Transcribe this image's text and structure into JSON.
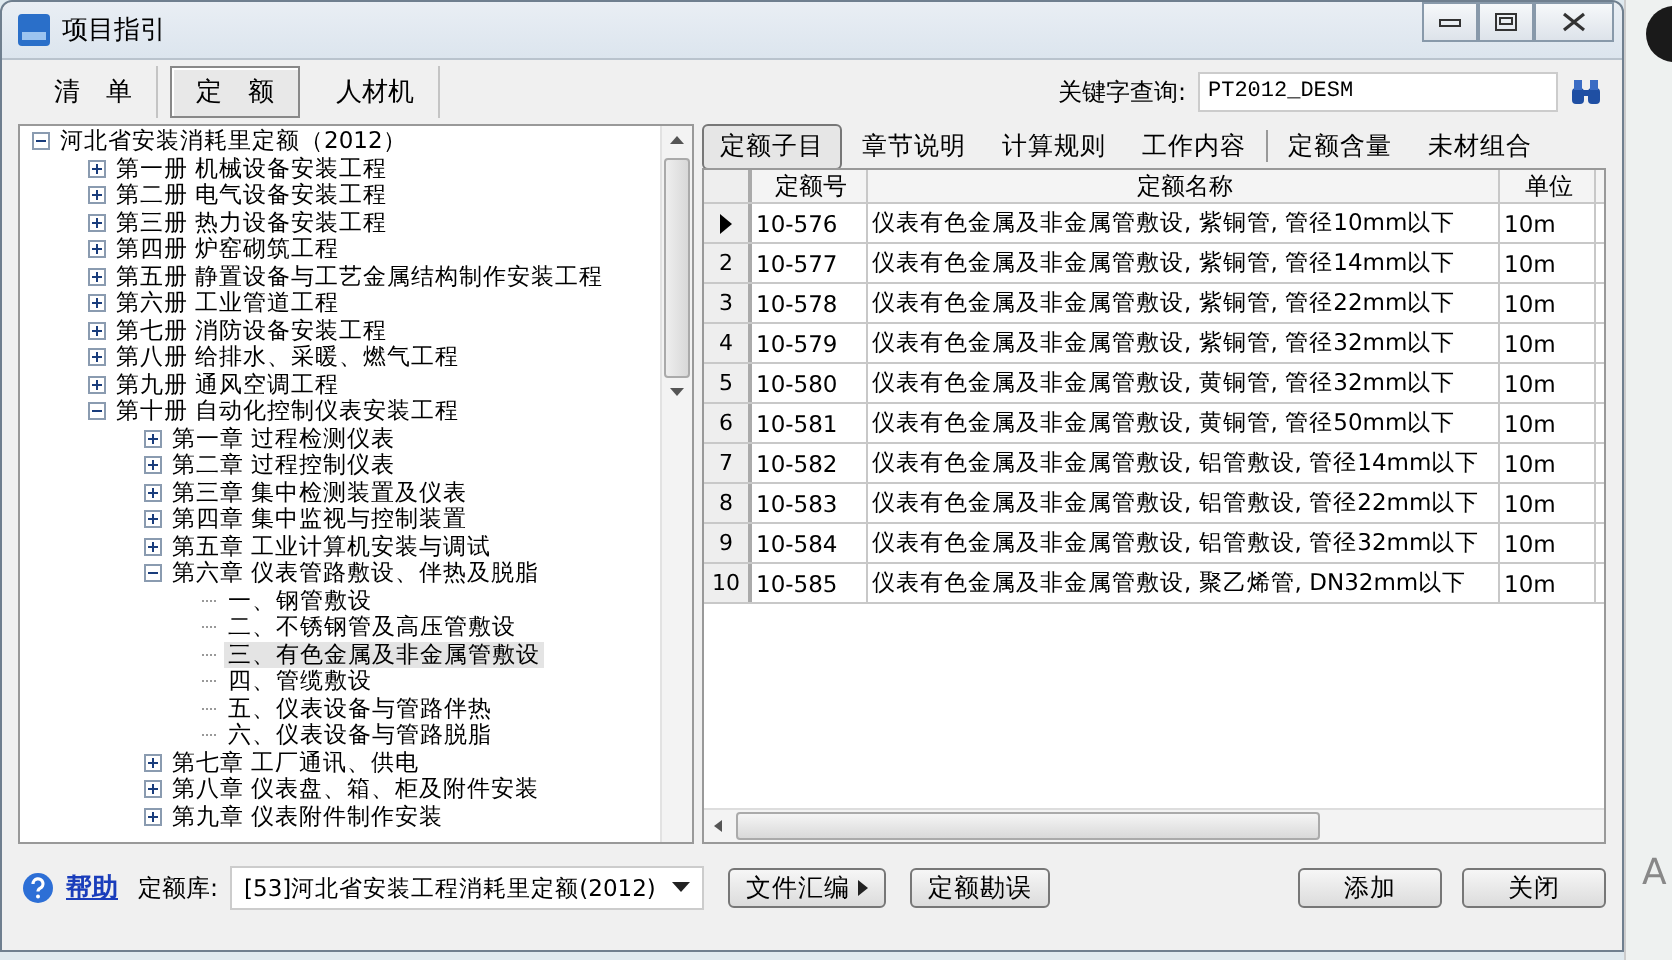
{
  "window": {
    "title": "项目指引"
  },
  "mode_tabs": [
    {
      "label": "清　单",
      "selected": false
    },
    {
      "label": "定　额",
      "selected": true
    },
    {
      "label": "人材机",
      "selected": false
    }
  ],
  "search": {
    "label": "关键字查询:",
    "value": "PT2012_DESM"
  },
  "tree": [
    {
      "label": "河北省安装消耗里定额（2012）",
      "expanded": true,
      "children": [
        {
          "label": "第一册  机械设备安装工程",
          "expanded": false
        },
        {
          "label": "第二册  电气设备安装工程",
          "expanded": false
        },
        {
          "label": "第三册  热力设备安装工程",
          "expanded": false
        },
        {
          "label": "第四册  炉窑砌筑工程",
          "expanded": false
        },
        {
          "label": "第五册  静置设备与工艺金属结构制作安装工程",
          "expanded": false
        },
        {
          "label": "第六册  工业管道工程",
          "expanded": false
        },
        {
          "label": "第七册  消防设备安装工程",
          "expanded": false
        },
        {
          "label": "第八册  给排水、采暖、燃气工程",
          "expanded": false
        },
        {
          "label": "第九册  通风空调工程",
          "expanded": false
        },
        {
          "label": "第十册  自动化控制仪表安装工程",
          "expanded": true,
          "children": [
            {
              "label": "第一章  过程检测仪表",
              "expanded": false
            },
            {
              "label": "第二章  过程控制仪表",
              "expanded": false
            },
            {
              "label": "第三章  集中检测装置及仪表",
              "expanded": false
            },
            {
              "label": "第四章  集中监视与控制装置",
              "expanded": false
            },
            {
              "label": "第五章  工业计算机安装与调试",
              "expanded": false
            },
            {
              "label": "第六章  仪表管路敷设、伴热及脱脂",
              "expanded": true,
              "children": [
                {
                  "label": "一、钢管敷设",
                  "selected": false
                },
                {
                  "label": "二、不锈钢管及高压管敷设",
                  "selected": false
                },
                {
                  "label": "三、有色金属及非金属管敷设",
                  "selected": true
                },
                {
                  "label": "四、管缆敷设",
                  "selected": false
                },
                {
                  "label": "五、仪表设备与管路伴热",
                  "selected": false
                },
                {
                  "label": "六、仪表设备与管路脱脂",
                  "selected": false
                }
              ]
            },
            {
              "label": "第七章  工厂通讯、供电",
              "expanded": false
            },
            {
              "label": "第八章  仪表盘、箱、柜及附件安装",
              "expanded": false
            },
            {
              "label": "第九章  仪表附件制作安装",
              "expanded": false
            }
          ]
        }
      ]
    }
  ],
  "detail_tabs": [
    {
      "label": "定额子目",
      "selected": true
    },
    {
      "label": "章节说明",
      "selected": false
    },
    {
      "label": "计算规则",
      "selected": false
    },
    {
      "label": "工作内容",
      "selected": false
    },
    {
      "label": "定额含量",
      "selected": false
    },
    {
      "label": "未材组合",
      "selected": false
    }
  ],
  "table": {
    "columns": [
      "定额号",
      "定额名称",
      "单位"
    ],
    "rows": [
      {
        "current": true,
        "cells": [
          "10-576",
          "仪表有色金属及非金属管敷设, 紫铜管, 管径10mm以下",
          "10m"
        ]
      },
      {
        "index": "2",
        "current": false,
        "cells": [
          "10-577",
          "仪表有色金属及非金属管敷设, 紫铜管, 管径14mm以下",
          "10m"
        ]
      },
      {
        "index": "3",
        "current": false,
        "cells": [
          "10-578",
          "仪表有色金属及非金属管敷设, 紫铜管, 管径22mm以下",
          "10m"
        ]
      },
      {
        "index": "4",
        "current": false,
        "cells": [
          "10-579",
          "仪表有色金属及非金属管敷设, 紫铜管, 管径32mm以下",
          "10m"
        ]
      },
      {
        "index": "5",
        "current": false,
        "cells": [
          "10-580",
          "仪表有色金属及非金属管敷设, 黄铜管, 管径32mm以下",
          "10m"
        ]
      },
      {
        "index": "6",
        "current": false,
        "cells": [
          "10-581",
          "仪表有色金属及非金属管敷设, 黄铜管, 管径50mm以下",
          "10m"
        ]
      },
      {
        "index": "7",
        "current": false,
        "cells": [
          "10-582",
          "仪表有色金属及非金属管敷设, 铝管敷设, 管径14mm以下",
          "10m"
        ]
      },
      {
        "index": "8",
        "current": false,
        "cells": [
          "10-583",
          "仪表有色金属及非金属管敷设, 铝管敷设, 管径22mm以下",
          "10m"
        ]
      },
      {
        "index": "9",
        "current": false,
        "cells": [
          "10-584",
          "仪表有色金属及非金属管敷设, 铝管敷设, 管径32mm以下",
          "10m"
        ]
      },
      {
        "index": "10",
        "current": false,
        "cells": [
          "10-585",
          "仪表有色金属及非金属管敷设, 聚乙烯管, DN32mm以下",
          "10m"
        ]
      }
    ]
  },
  "footer": {
    "help": "帮助",
    "library_label": "定额库:",
    "library": "[53]河北省安装工程消耗里定额(2012)",
    "buttons": [
      {
        "label": "文件汇编",
        "kind": "menu"
      },
      {
        "label": "定额勘误",
        "kind": "plain"
      },
      {
        "label": "添加",
        "kind": "plain"
      },
      {
        "label": "关闭",
        "kind": "plain"
      }
    ]
  },
  "side_strip": {
    "letter": "A"
  }
}
